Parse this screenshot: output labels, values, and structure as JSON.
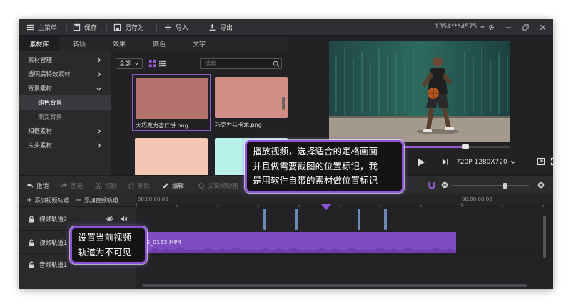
{
  "topbar": {
    "main_menu": "主菜单",
    "save": "保存",
    "save_as": "另存为",
    "import": "导入",
    "export": "导出",
    "account": "1354***4575"
  },
  "tabs": [
    "素材库",
    "转场",
    "效果",
    "颜色",
    "文字"
  ],
  "sidebar": {
    "items": [
      {
        "label": "素材管理"
      },
      {
        "label": "透明底特效素材"
      },
      {
        "label": "背景素材"
      },
      {
        "label": "纯色背景"
      },
      {
        "label": "渐变背景"
      },
      {
        "label": "相框素材"
      },
      {
        "label": "片头素材"
      }
    ]
  },
  "browser": {
    "filter": "全部",
    "search_placeholder": "搜索",
    "assets": [
      {
        "name": "大巧克力杏仁饼.png",
        "color": "#b5726c"
      },
      {
        "name": "巧克力马卡龙.png",
        "color": "#d08e84"
      },
      {
        "name": "",
        "color": "#f3c6b4"
      },
      {
        "name": "",
        "color": "#b8f1ea"
      }
    ]
  },
  "preview": {
    "resolution": "720P 1280X720",
    "progress": 0.75
  },
  "edit_toolbar": {
    "undo": "撤销",
    "redo": "回退",
    "cut": "切割",
    "delete": "删除",
    "edit": "编辑",
    "keyframe": "关键帧动画"
  },
  "tracks": {
    "add_video": "添加视频轨道",
    "add_audio": "添加音频轨道",
    "video2": "视频轨道2",
    "video1": "视频轨道1",
    "audio1": "音频轨道1"
  },
  "ruler": {
    "start": "00:00:00;00",
    "mid": "00:00:08;00"
  },
  "clip": {
    "label": "MG_0153.MP4"
  },
  "callouts": {
    "preview": [
      "播放视频，选择适合的定格画面",
      "并且做需要截图的位置标记，我",
      "是用软件自带的素材做位置标记"
    ],
    "track": [
      "设置当前视频",
      "轨道为不可见"
    ]
  },
  "colors": {
    "accent": "#8d52d6",
    "clip": "#7e4cc2",
    "marker": "#6d89b8"
  }
}
